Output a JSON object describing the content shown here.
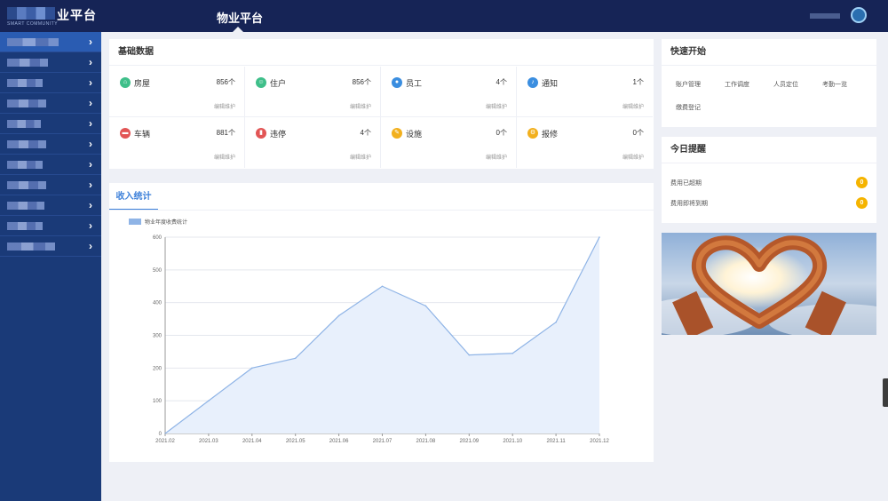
{
  "header": {
    "logo_text": "业平台",
    "logo_subtext": "SMART COMMUNITY",
    "nav_title": "物业平台"
  },
  "sidebar": {
    "items": [
      {
        "active": true
      },
      {
        "active": false
      },
      {
        "active": false
      },
      {
        "active": false
      },
      {
        "active": false
      },
      {
        "active": false
      },
      {
        "active": false
      },
      {
        "active": false
      },
      {
        "active": false
      },
      {
        "active": false
      },
      {
        "active": false
      }
    ]
  },
  "basic": {
    "title": "基础数据",
    "edit_label": "编辑维护",
    "cells": [
      {
        "name": "房屋",
        "count": "856个",
        "icon": "house-icon",
        "color": "#3fbf8a"
      },
      {
        "name": "住户",
        "count": "856个",
        "icon": "resident-icon",
        "color": "#3fbf8a"
      },
      {
        "name": "员工",
        "count": "4个",
        "icon": "staff-icon",
        "color": "#3b8ee0"
      },
      {
        "name": "通知",
        "count": "1个",
        "icon": "bell-icon",
        "color": "#3b8ee0"
      },
      {
        "name": "车辆",
        "count": "881个",
        "icon": "car-icon",
        "color": "#e25555"
      },
      {
        "name": "违停",
        "count": "4个",
        "icon": "parking-violation-icon",
        "color": "#e25555"
      },
      {
        "name": "设施",
        "count": "0个",
        "icon": "facility-icon",
        "color": "#f2b01e"
      },
      {
        "name": "报修",
        "count": "0个",
        "icon": "repair-icon",
        "color": "#f2b01e"
      }
    ]
  },
  "income": {
    "tab_label": "收入统计"
  },
  "chart_data": {
    "type": "area",
    "x": [
      "2021.02",
      "2021.03",
      "2021.04",
      "2021.05",
      "2021.06",
      "2021.07",
      "2021.08",
      "2021.09",
      "2021.10",
      "2021.11",
      "2021.12"
    ],
    "series": [
      {
        "name": "物业年度收费统计",
        "values": [
          0,
          100,
          200,
          230,
          360,
          450,
          390,
          240,
          245,
          340,
          600
        ],
        "color": "#8fb4e6",
        "fill": "#e8f0fc"
      }
    ],
    "yticks": [
      0,
      100,
      200,
      300,
      400,
      500,
      600
    ],
    "ylim": [
      0,
      600
    ],
    "grid": true,
    "legend": "top-left"
  },
  "quick_start": {
    "title": "快速开始",
    "items": [
      "账户管理",
      "工作调度",
      "人员定位",
      "考勤一览",
      "缴费登记"
    ]
  },
  "reminders": {
    "title": "今日提醒",
    "items": [
      {
        "label": "费用已超期",
        "count": "0"
      },
      {
        "label": "费用即将到期",
        "count": "0"
      }
    ]
  }
}
